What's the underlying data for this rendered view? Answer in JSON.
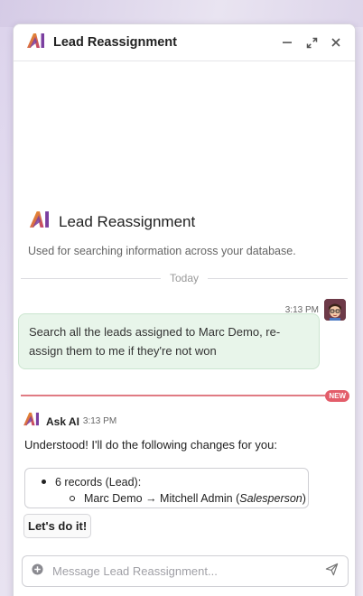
{
  "header": {
    "title": "Lead Reassignment",
    "icons": [
      "minimize-icon",
      "expand-icon",
      "close-icon"
    ]
  },
  "intro": {
    "title": "Lead Reassignment",
    "description": "Used for searching information across your database."
  },
  "divider_label": "Today",
  "user_message": {
    "time": "3:13 PM",
    "text": "Search all the leads assigned to Marc Demo, re-assign them to me if they're not won"
  },
  "new_badge": "NEW",
  "ai_message": {
    "author": "Ask AI",
    "time": "3:13 PM",
    "text": "Understood! I'll do the following changes for you:",
    "changes": {
      "records": "6 records (Lead):",
      "change_prefix": "Marc Demo → Mitchell Admin (",
      "field": "Salesperson",
      "change_suffix": ")"
    },
    "action_label": "Let's do it!"
  },
  "composer": {
    "placeholder": "Message Lead Reassignment..."
  },
  "colors": {
    "user_bubble": "#e8f5ea",
    "new_line": "#e07b83",
    "logo_orange": "#f0a21a",
    "logo_purple": "#7b3fa0"
  }
}
